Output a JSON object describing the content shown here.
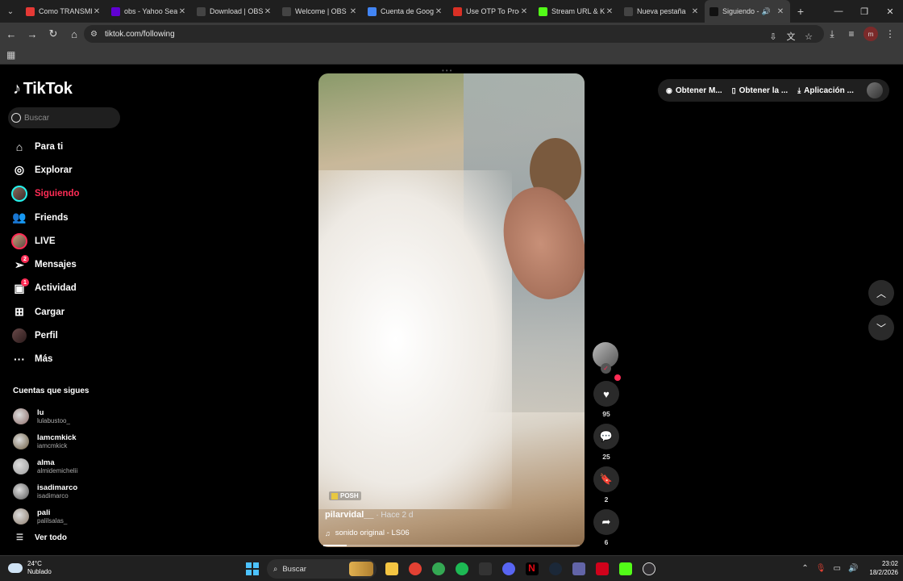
{
  "browser": {
    "tabs": [
      {
        "title": "Como TRANSMITIR",
        "favicon_color": "#e53935",
        "icon": "youtube-icon"
      },
      {
        "title": "obs - Yahoo Search",
        "favicon_color": "#6001d2",
        "icon": "yahoo-icon"
      },
      {
        "title": "Download | OBS",
        "favicon_color": "#444444",
        "icon": "globe-icon"
      },
      {
        "title": "Welcome | OBS",
        "favicon_color": "#444444",
        "icon": "globe-icon"
      },
      {
        "title": "Cuenta de Google",
        "favicon_color": "#4285f4",
        "icon": "google-icon"
      },
      {
        "title": "Use OTP To Proceed",
        "favicon_color": "#d93025",
        "icon": "gmail-icon"
      },
      {
        "title": "Stream URL & Key",
        "favicon_color": "#53fc18",
        "icon": "kick-icon"
      },
      {
        "title": "Nueva pestaña",
        "favicon_color": "#444444",
        "icon": "globe-icon"
      },
      {
        "title": "Siguiendo -",
        "favicon_color": "#111111",
        "icon": "tiktok-icon",
        "active": true
      }
    ],
    "url": "tiktok.com/following",
    "profile_initial": "m"
  },
  "sidebar": {
    "brand": "TikTok",
    "search_placeholder": "Buscar",
    "nav": [
      {
        "label": "Para ti",
        "icon": "home-icon"
      },
      {
        "label": "Explorar",
        "icon": "compass-icon"
      },
      {
        "label": "Siguiendo",
        "icon": "following-avatar",
        "active": true
      },
      {
        "label": "Friends",
        "icon": "friends-icon"
      },
      {
        "label": "LIVE",
        "icon": "live-avatar"
      },
      {
        "label": "Mensajes",
        "icon": "paper-plane-icon",
        "badge": "2"
      },
      {
        "label": "Actividad",
        "icon": "activity-icon",
        "badge": "1"
      },
      {
        "label": "Cargar",
        "icon": "upload-icon"
      },
      {
        "label": "Perfil",
        "icon": "profile-avatar"
      },
      {
        "label": "Más",
        "icon": "more-icon"
      }
    ],
    "following_title": "Cuentas que sigues",
    "following": [
      {
        "name": "lu",
        "handle": "lulabustoo_"
      },
      {
        "name": "Iamcmkick",
        "handle": "iamcmkick"
      },
      {
        "name": "alma",
        "handle": "almidemichelii"
      },
      {
        "name": "isadimarco",
        "handle": "isadimarco"
      },
      {
        "name": "pali",
        "handle": "palilsalas_"
      }
    ],
    "see_all": "Ver todo"
  },
  "video": {
    "tag": "POSH",
    "creator": "pilarvidal__",
    "time": " · Hace 2 d",
    "sound": "sonido original - LS06",
    "progress": 0.09
  },
  "actions": [
    {
      "icon": "heart-icon",
      "count": "95"
    },
    {
      "icon": "comment-icon",
      "count": "25"
    },
    {
      "icon": "bookmark-icon",
      "count": "2"
    },
    {
      "icon": "share-icon",
      "count": "6"
    }
  ],
  "top_right": {
    "items": [
      {
        "label": "Obtener M...",
        "icon": "coin-icon"
      },
      {
        "label": "Obtener la ...",
        "icon": "phone-icon"
      },
      {
        "label": "Aplicación ...",
        "icon": "download-icon"
      }
    ]
  },
  "taskbar": {
    "temperature": "24°C",
    "condition": "Nublado",
    "search": "Buscar",
    "time": "23:02",
    "date": "18/2/2026"
  }
}
